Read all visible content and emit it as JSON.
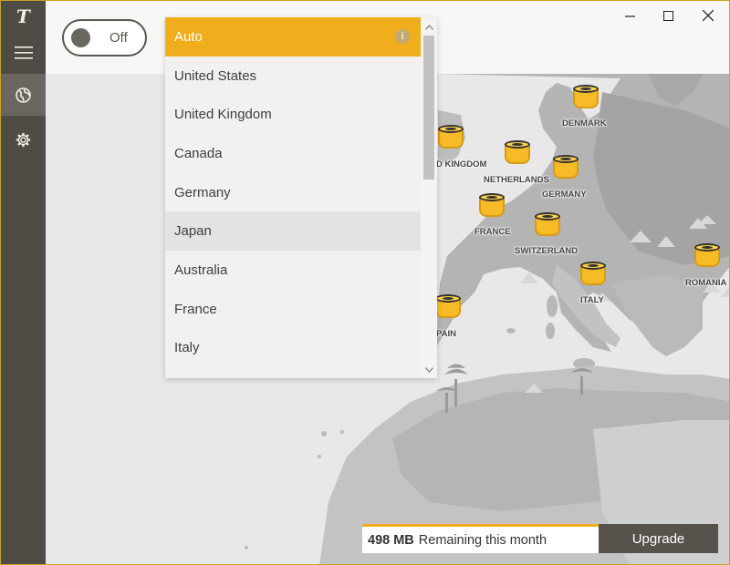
{
  "sidebar": {
    "logo": "T",
    "menu_icon": "hamburger-icon",
    "globe_icon": "globe-icon",
    "settings_icon": "gear-icon"
  },
  "toggle": {
    "label": "Off",
    "state": "off"
  },
  "window_controls": {
    "minimize": "–",
    "maximize": "□",
    "close": "✕"
  },
  "dropdown": {
    "selected": "Auto",
    "info_icon": "i",
    "items": [
      "United States",
      "United Kingdom",
      "Canada",
      "Germany",
      "Japan",
      "Australia",
      "France",
      "Italy"
    ],
    "hovered": "Japan"
  },
  "map": {
    "locations": [
      "DENMARK",
      "UNITED KINGDOM",
      "NETHERLANDS",
      "GERMANY",
      "FRANCE",
      "SWITZERLAND",
      "ITALY",
      "ROMANIA",
      "SPAIN"
    ],
    "visible_labels": [
      "DENMARK",
      "D KINGDOM",
      "NETHERLANDS",
      "GERMANY",
      "FRANCE",
      "SWITZERLAND",
      "ITALY",
      "ROMANIA",
      "PAIN"
    ]
  },
  "status": {
    "amount": "498 MB",
    "text": "Remaining this month"
  },
  "upgrade_label": "Upgrade",
  "colors": {
    "accent": "#f0ae1c",
    "sidebar": "#4f4b45",
    "button": "#57534c"
  }
}
